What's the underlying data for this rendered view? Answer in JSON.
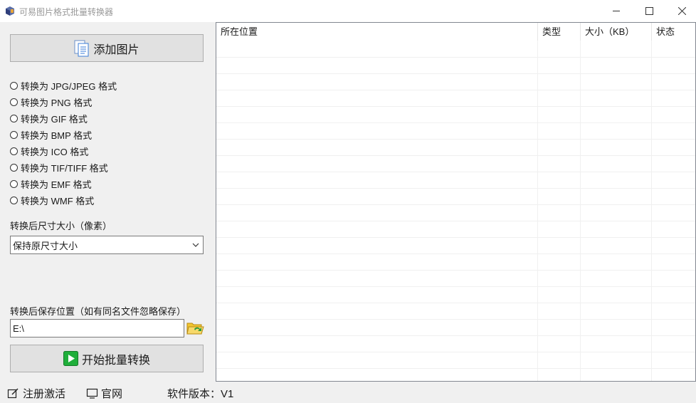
{
  "window": {
    "title": "可易图片格式批量转换器",
    "icon": "app-logo-icon",
    "controls": [
      "minimize-icon",
      "maximize-icon",
      "close-icon"
    ]
  },
  "left_panel": {
    "add_button": {
      "label": "添加图片",
      "icon": "document-icon"
    },
    "formats": [
      "转换为 JPG/JPEG 格式",
      "转换为 PNG 格式",
      "转换为 GIF 格式",
      "转换为 BMP 格式",
      "转换为 ICO 格式",
      "转换为 TIF/TIFF 格式",
      "转换为 EMF 格式",
      "转换为 WMF 格式"
    ],
    "size_label": "转换后尺寸大小（像素）",
    "size_select": "保持原尺寸大小",
    "save_label": "转换后保存位置（如有同名文件忽略保存）",
    "save_path": "E:\\",
    "start_button": {
      "label": "开始批量转换",
      "icon": "play-icon"
    }
  },
  "file_list": {
    "columns": [
      "所在位置",
      "类型",
      "大小（KB）",
      "状态"
    ],
    "rows": []
  },
  "statusbar": {
    "register": "注册激活",
    "website": "官网",
    "version": "软件版本：V1"
  },
  "colors": {
    "play_green": "#1fae3a",
    "folder_yellow": "#f2c530",
    "doc_blue": "#3b7dd8"
  }
}
